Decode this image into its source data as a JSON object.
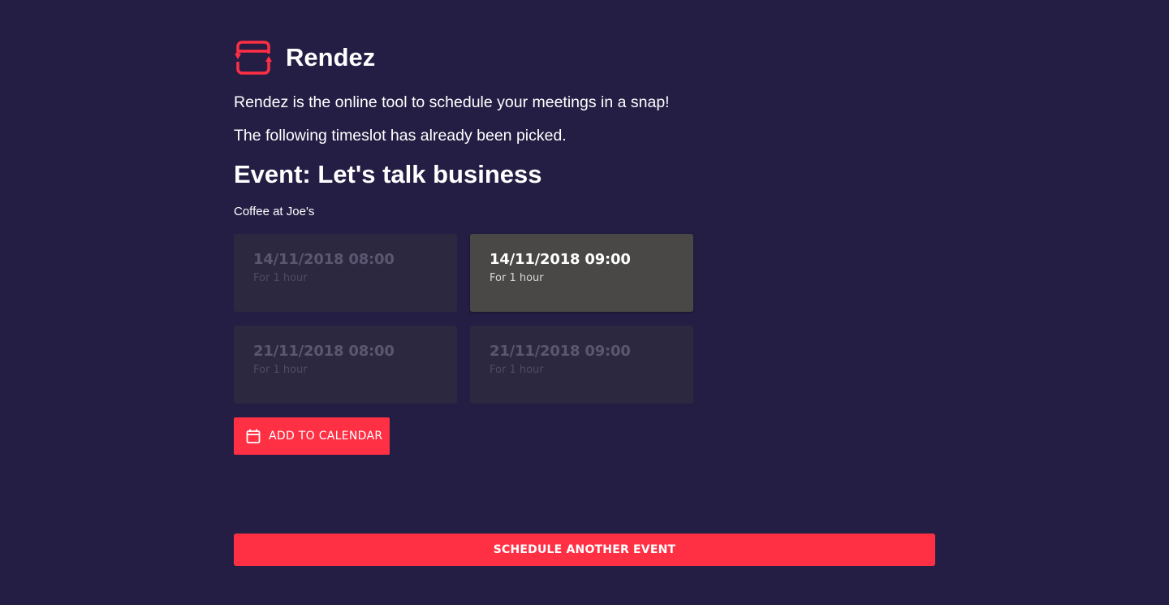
{
  "app": {
    "name": "Rendez",
    "logo_icon": "calendar-sync-logo-icon",
    "accent_color": "#ff2f44",
    "background_color": "#241e44"
  },
  "intro": "Rendez is the online tool to schedule your meetings in a snap!",
  "status_message": "The following timeslot has already been picked.",
  "event": {
    "title": "Event: Let's talk business",
    "location": "Coffee at Joe's"
  },
  "timeslots": [
    {
      "date": "14/11/2018 08:00",
      "duration": "For 1 hour",
      "selected": false
    },
    {
      "date": "14/11/2018 09:00",
      "duration": "For 1 hour",
      "selected": true
    },
    {
      "date": "21/11/2018 08:00",
      "duration": "For 1 hour",
      "selected": false
    },
    {
      "date": "21/11/2018 09:00",
      "duration": "For 1 hour",
      "selected": false
    }
  ],
  "actions": {
    "add_to_calendar": "ADD TO CALENDAR",
    "add_to_calendar_icon": "calendar-icon",
    "schedule_another": "SCHEDULE ANOTHER EVENT"
  }
}
